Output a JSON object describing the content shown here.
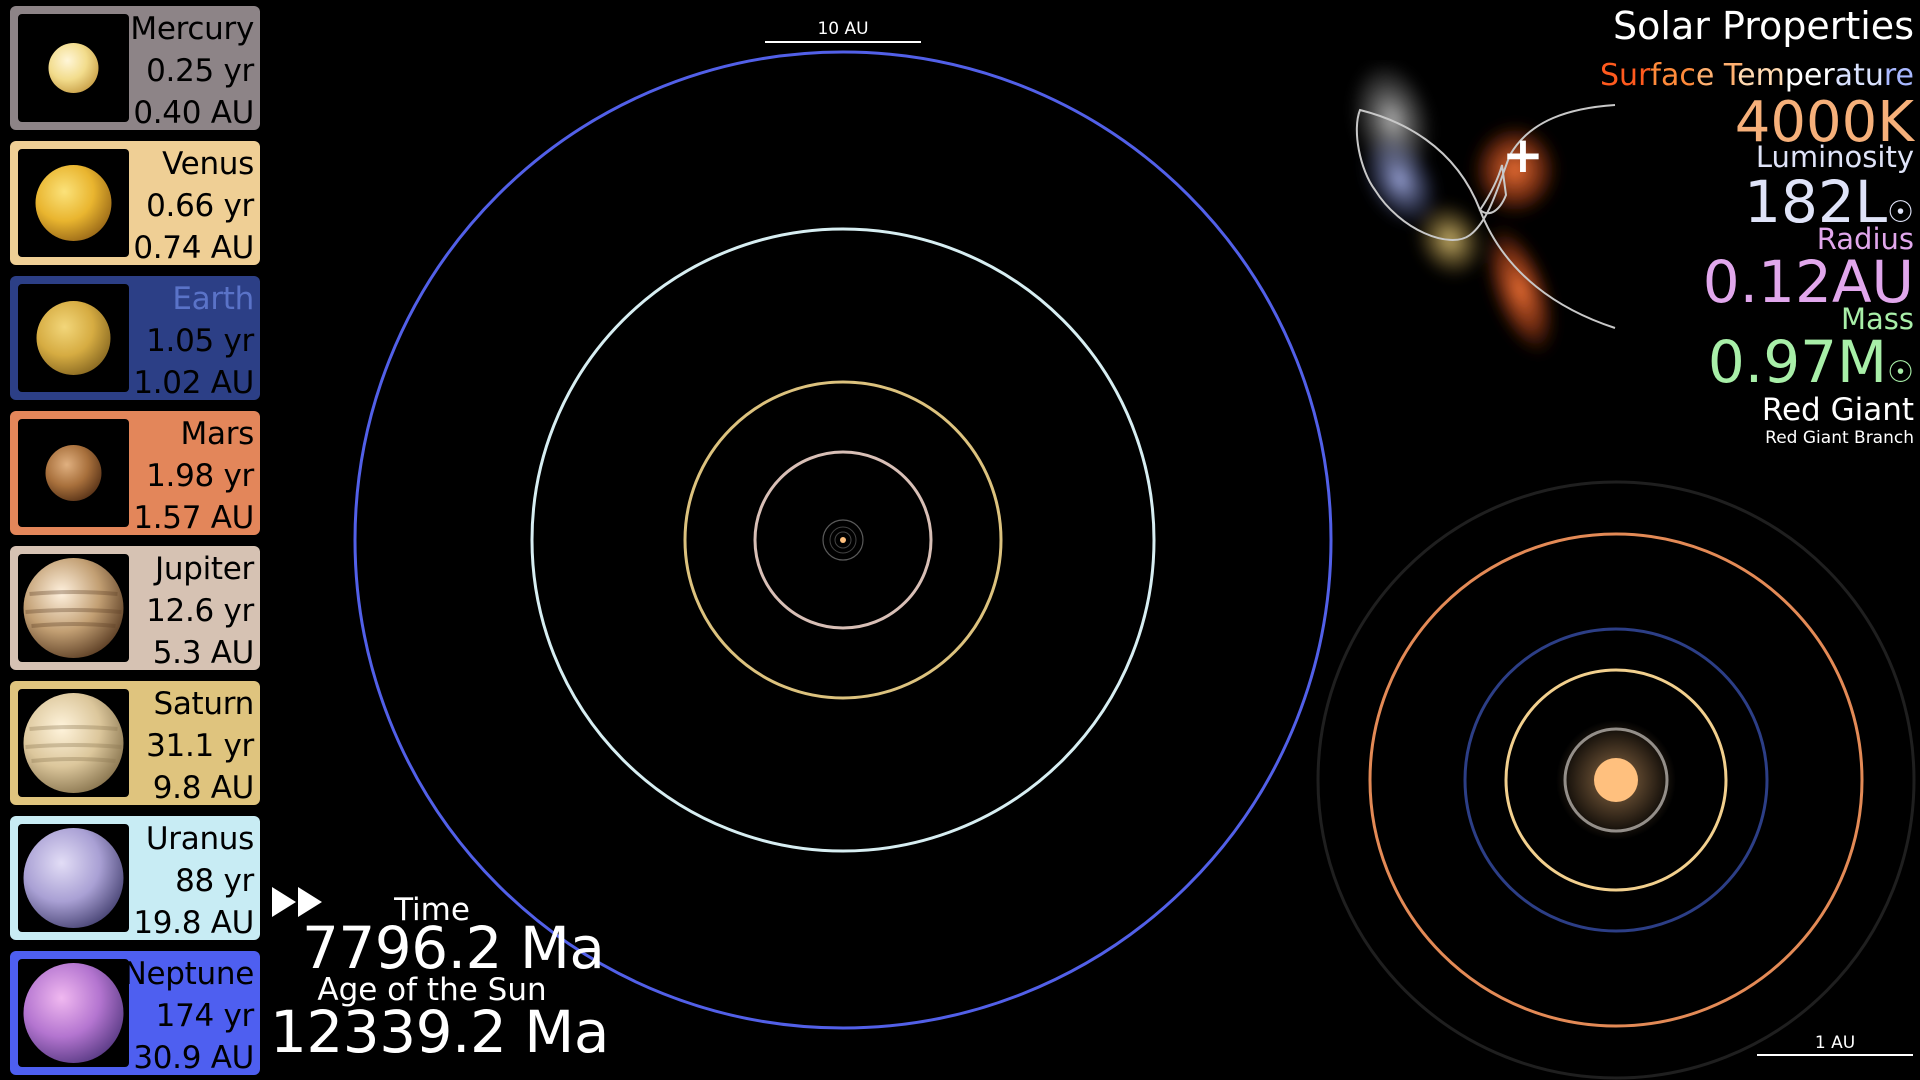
{
  "planets": [
    {
      "name": "Mercury",
      "period": "0.25 yr",
      "distance": "0.40 AU",
      "card_color": "#8d8487",
      "planet_colors": [
        "#fff6d8",
        "#f2dc8c",
        "#caa24a"
      ]
    },
    {
      "name": "Venus",
      "period": "0.66 yr",
      "distance": "0.74 AU",
      "card_color": "#efcf95",
      "planet_colors": [
        "#fbe27a",
        "#e9b52f",
        "#9b6a18"
      ]
    },
    {
      "name": "Earth",
      "period": "1.05 yr",
      "distance": "1.02 AU",
      "card_color": "#2c3f86",
      "planet_colors": [
        "#f2d67a",
        "#d6ac42",
        "#8a6a22"
      ]
    },
    {
      "name": "Mars",
      "period": "1.98 yr",
      "distance": "1.57 AU",
      "card_color": "#e3865a",
      "planet_colors": [
        "#e0b080",
        "#a8703c",
        "#5a3418"
      ]
    },
    {
      "name": "Jupiter",
      "period": "12.6 yr",
      "distance": "5.3 AU",
      "card_color": "#d6c2b3",
      "planet_colors": [
        "#fff1de",
        "#c29f73",
        "#5e4026"
      ]
    },
    {
      "name": "Saturn",
      "period": "31.1 yr",
      "distance": "9.8 AU",
      "card_color": "#dfc47e",
      "planet_colors": [
        "#fff4dc",
        "#dcc79c",
        "#8a7650"
      ]
    },
    {
      "name": "Uranus",
      "period": "88 yr",
      "distance": "19.8 AU",
      "card_color": "#c8ecf4",
      "planet_colors": [
        "#e2ddf6",
        "#a9a0d4",
        "#4a4676"
      ]
    },
    {
      "name": "Neptune",
      "period": "174 yr",
      "distance": "30.9 AU",
      "card_color": "#4e5ff0",
      "planet_colors": [
        "#f0b8f0",
        "#b475d0",
        "#5b3c86"
      ]
    }
  ],
  "playback": {
    "icon": "fast-forward-icon"
  },
  "time": {
    "label": "Time",
    "value": "7796.2 Ma"
  },
  "age": {
    "label": "Age of the Sun",
    "value": "12339.2 Ma"
  },
  "main_view": {
    "scale_label": "10 AU",
    "orbit_colors": [
      "#5260e8",
      "#d7eef2",
      "#dcc27e",
      "#d8bfb6",
      "#c8c8c8"
    ]
  },
  "inner_view": {
    "scale_label": "1 AU",
    "orbit_colors": [
      "#1f1f1f",
      "#e38a56",
      "#2c3e86",
      "#f2d08e",
      "#8a8a8a"
    ],
    "sun_color": "#ffc07e"
  },
  "solar": {
    "title": "Solar Properties",
    "temperature_label": "Surface Temperature",
    "temperature_value": "4000K",
    "luminosity_label": "Luminosity",
    "luminosity_value": "182L",
    "radius_label": "Radius",
    "radius_value": "0.12AU",
    "mass_label": "Mass",
    "mass_value": "0.97M",
    "solar_symbol": "☉",
    "stage": "Red Giant",
    "phase": "Red Giant Branch"
  },
  "hr_diagram": {
    "marker": "+"
  }
}
